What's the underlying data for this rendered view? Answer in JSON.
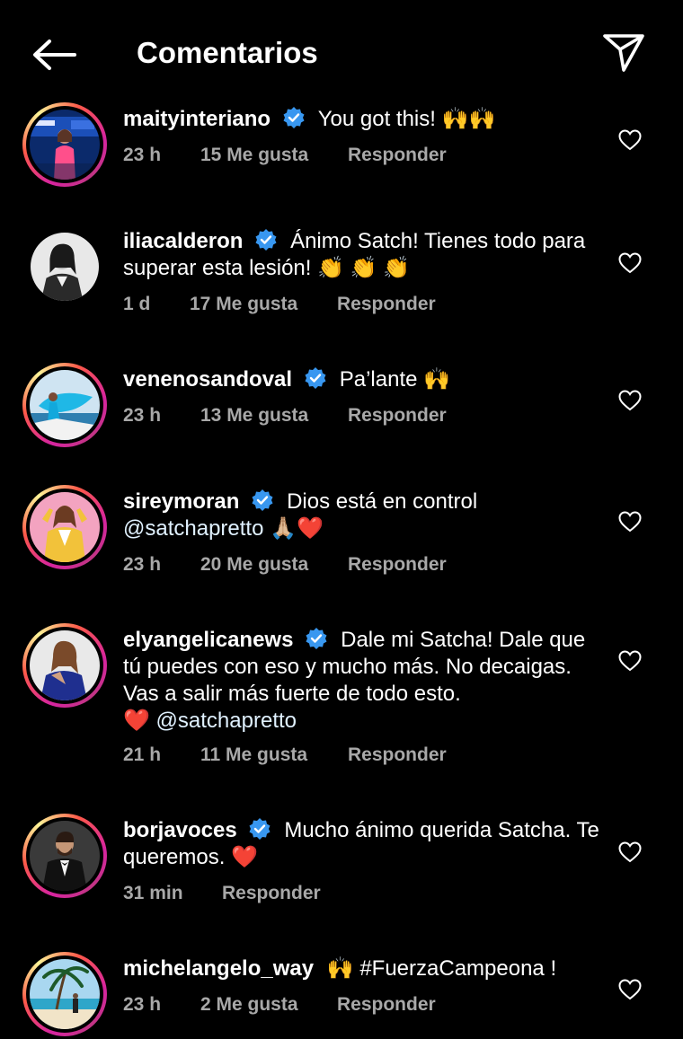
{
  "header": {
    "title": "Comentarios",
    "back_icon": "arrow-left-icon",
    "send_icon": "paper-plane-icon"
  },
  "colors": {
    "background": "#000000",
    "text": "#ffffff",
    "meta": "#a8a8a8",
    "verified": "#3897f0",
    "heart_red": "#e0245e"
  },
  "comments": [
    {
      "username": "maityinteriano",
      "verified": true,
      "text": "You got this! 🙌🙌",
      "time": "23 h",
      "likes": "15 Me gusta",
      "reply": "Responder"
    },
    {
      "username": "iliacalderon",
      "verified": true,
      "text": "Ánimo Satch! Tienes todo para superar esta lesión! 👏 👏 👏",
      "time": "1 d",
      "likes": "17 Me gusta",
      "reply": "Responder"
    },
    {
      "username": "venenosandoval",
      "verified": true,
      "text": "Pa’lante 🙌",
      "time": "23 h",
      "likes": "13 Me gusta",
      "reply": "Responder"
    },
    {
      "username": "sireymoran",
      "verified": true,
      "text": "Dios está en control",
      "mention": "@satchapretto 🙏🏼❤️",
      "time": "23 h",
      "likes": "20 Me gusta",
      "reply": "Responder"
    },
    {
      "username": "elyangelicanews",
      "verified": true,
      "text": "Dale mi Satcha! Dale que tú puedes con eso y mucho más. No decaigas. Vas a salir más fuerte de todo esto.",
      "mention": "❤️ @satchapretto",
      "time": "21 h",
      "likes": "11 Me gusta",
      "reply": "Responder"
    },
    {
      "username": "borjavoces",
      "verified": true,
      "text": "Mucho ánimo querida Satcha. Te queremos. ❤️",
      "time": "31 min",
      "likes": "",
      "reply": "Responder"
    },
    {
      "username": "michelangelo_way",
      "verified": false,
      "text": "🙌 #FuerzaCampeona !",
      "time": "23 h",
      "likes": "2 Me gusta",
      "reply": "Responder"
    }
  ]
}
